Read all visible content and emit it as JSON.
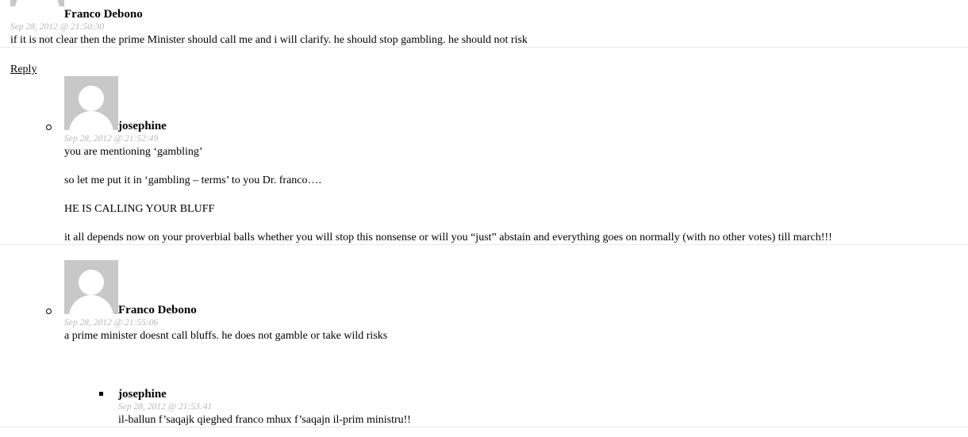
{
  "comments": [
    {
      "author": "Franco Debono",
      "date": "Sep 28, 2012 @ 21:50:30",
      "paragraphs": [
        "if it is not clear then the prime Minister should call me and i will clarify. he should stop gambling. he should not risk"
      ],
      "reply_label": "Reply"
    },
    {
      "author": "josephine",
      "date": "Sep 28, 2012 @ 21:52:49",
      "paragraphs": [
        "you are mentioning ‘gambling’",
        "so let me put it in ‘gambling – terms’ to you Dr. franco….",
        "HE IS CALLING YOUR BLUFF",
        "it all depends now on your proverbial balls whether you will stop this nonsense or will you “just” abstain and everything goes on normally (with no other votes) till march!!!"
      ]
    },
    {
      "author": "Franco Debono",
      "date": "Sep 28, 2012 @ 21:55:06",
      "paragraphs": [
        "a prime minister doesnt call bluffs. he does not gamble or take wild risks"
      ]
    },
    {
      "author": "josephine",
      "date": "Sep 28, 2012 @ 21:53:41",
      "paragraphs": [
        "il-ballun f’saqajk qieghed franco mhux f’saqajn il-prim ministru!!"
      ]
    }
  ]
}
